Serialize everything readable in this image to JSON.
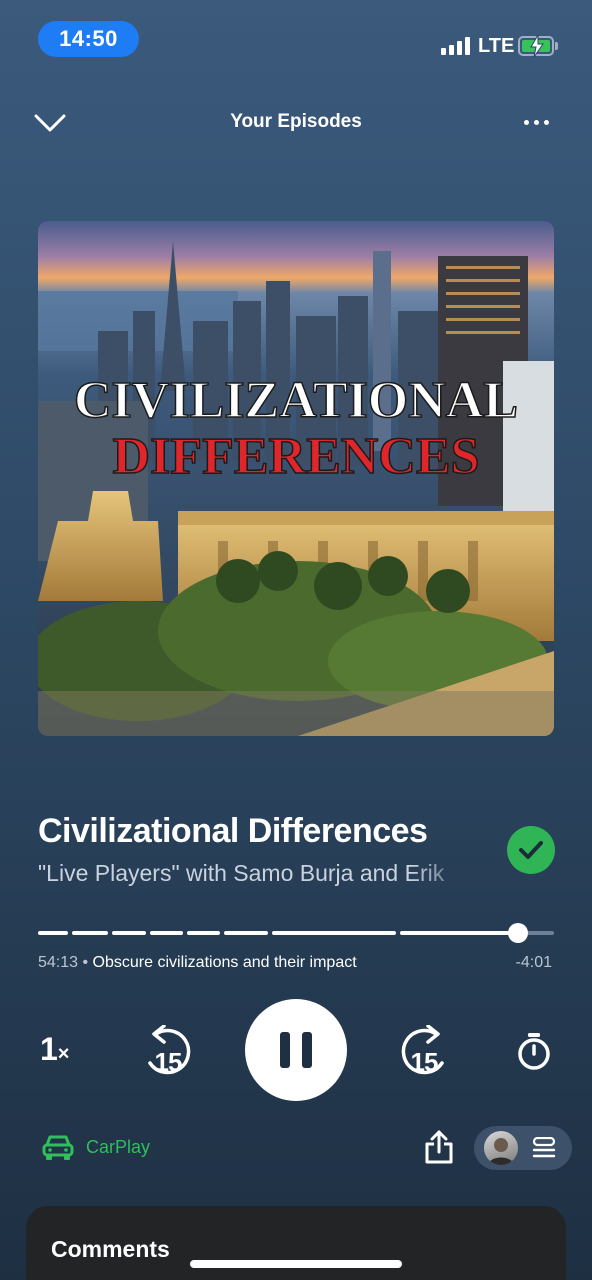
{
  "status_bar": {
    "time": "14:50",
    "network": "LTE",
    "battery_charging": true
  },
  "header": {
    "title": "Your Episodes",
    "back_icon": "chevron-down-icon",
    "menu_icon": "more-icon"
  },
  "artwork": {
    "line1": "CIVILIZATIONAL",
    "line2": "DIFFERENCES"
  },
  "episode": {
    "title": "Civilizational Differences",
    "subtitle": "\"Live Players\" with Samo Burja and Erik",
    "completed": true
  },
  "progress": {
    "elapsed": "54:13",
    "separator": " • ",
    "chapter": "Obscure civilizations and their impact",
    "remaining": "-4:01",
    "fraction": 0.93
  },
  "controls": {
    "speed_value": "1",
    "speed_suffix": "×",
    "rewind_seconds": "15",
    "forward_seconds": "15",
    "play_state": "playing"
  },
  "bottom": {
    "carplay_label": "CarPlay"
  },
  "comments": {
    "label": "Comments"
  },
  "colors": {
    "accent_green": "#2fb556",
    "carplay_green": "#2fbf5b",
    "status_blue": "#1e7df5"
  }
}
